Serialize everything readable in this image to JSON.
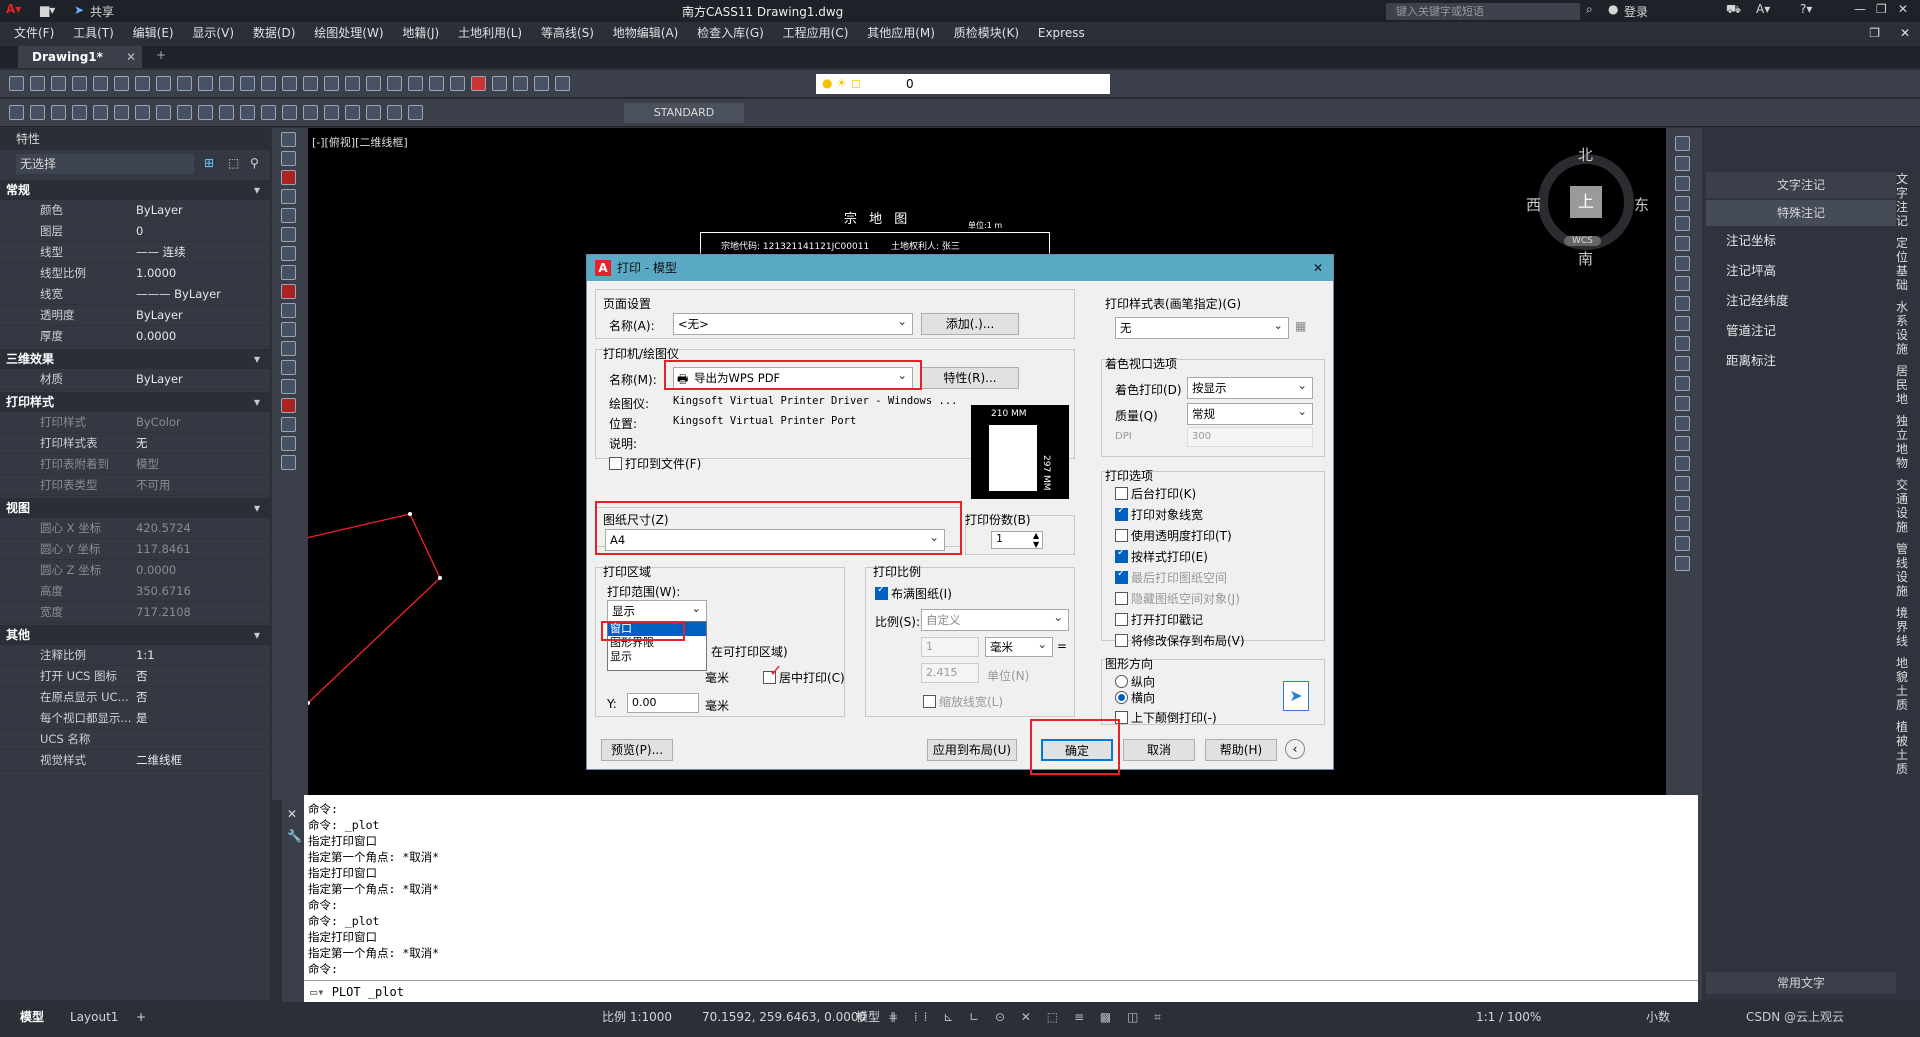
{
  "titlebar": {
    "share": "共享",
    "title": "南方CASS11    Drawing1.dwg",
    "search_placeholder": "键入关键字或短语",
    "login": "登录"
  },
  "menus": [
    "文件(F)",
    "工具(T)",
    "编辑(E)",
    "显示(V)",
    "数据(D)",
    "绘图处理(W)",
    "地籍(J)",
    "土地利用(L)",
    "等高线(S)",
    "地物编辑(A)",
    "检查入库(G)",
    "工程应用(C)",
    "其他应用(M)",
    "质检模块(K)",
    "Express"
  ],
  "tabs": {
    "drawing": "Drawing1*"
  },
  "toolbar": {
    "layer_value": "0",
    "textstyle": "STANDARD"
  },
  "properties": {
    "title": "特性",
    "selection": "无选择",
    "sections": [
      {
        "name": "常规",
        "rows": [
          [
            "颜色",
            "ByLayer"
          ],
          [
            "图层",
            "0"
          ],
          [
            "线型",
            "—— 连续"
          ],
          [
            "线型比例",
            "1.0000"
          ],
          [
            "线宽",
            "——— ByLayer"
          ],
          [
            "透明度",
            "ByLayer"
          ],
          [
            "厚度",
            "0.0000"
          ]
        ]
      },
      {
        "name": "三维效果",
        "rows": [
          [
            "材质",
            "ByLayer"
          ]
        ]
      },
      {
        "name": "打印样式",
        "rows": [
          [
            "打印样式",
            "ByColor"
          ],
          [
            "打印样式表",
            "无"
          ],
          [
            "打印表附着到",
            "模型"
          ],
          [
            "打印表类型",
            "不可用"
          ]
        ]
      },
      {
        "name": "视图",
        "rows": [
          [
            "圆心 X 坐标",
            "420.5724"
          ],
          [
            "圆心 Y 坐标",
            "117.8461"
          ],
          [
            "圆心 Z 坐标",
            "0.0000"
          ],
          [
            "高度",
            "350.6716"
          ],
          [
            "宽度",
            "717.2108"
          ]
        ]
      },
      {
        "name": "其他",
        "rows": [
          [
            "注释比例",
            "1:1"
          ],
          [
            "打开 UCS 图标",
            "否"
          ],
          [
            "在原点显示 UC...",
            "否"
          ],
          [
            "每个视口都显示...",
            "是"
          ],
          [
            "UCS 名称",
            ""
          ],
          [
            "视觉样式",
            "二维线框"
          ]
        ]
      }
    ]
  },
  "canvas": {
    "viewport_label": "[-][俯视][二维线框]",
    "compass": {
      "n": "北",
      "s": "南",
      "e": "东",
      "w": "西",
      "top": "上",
      "wcs": "WCS"
    },
    "drawing_title": "宗 地 图",
    "unit": "单位:1 m",
    "parcel_no": "宗地代码: 121321141121JC00011",
    "owner": "土地权利人: 张三"
  },
  "rightpanel": {
    "items": [
      "文字注记",
      "特殊注记",
      "注记坐标",
      "注记坪高",
      "注记经纬度",
      "管道注记",
      "距离标注"
    ],
    "bottom": "常用文字",
    "vtabs": [
      "文字注记",
      "定位基础",
      "水系设施",
      "居民地",
      "独立地物",
      "交通设施",
      "管线设施",
      "境界线",
      "地貌土质",
      "植被土质"
    ]
  },
  "command": {
    "lines": [
      "命令:",
      "命令: _plot",
      "指定打印窗口",
      "指定第一个角点: *取消*",
      "指定打印窗口",
      "指定第一个角点: *取消*",
      "命令:",
      "命令: _plot",
      "指定打印窗口",
      "指定第一个角点: *取消*",
      "命令:"
    ],
    "input": "PLOT _plot"
  },
  "status": {
    "tab_model": "模型",
    "tab_layout": "Layout1",
    "scale": "比例 1:1000",
    "coords": "70.1592, 259.6463, 0.0000",
    "model": "模型",
    "zoom": "1:1 / 100%",
    "units": "小数",
    "watermark": "CSDN @云上观云"
  },
  "dialog": {
    "title": "打印 - 模型",
    "page_setup": {
      "label": "页面设置",
      "name_label": "名称(A):",
      "name_value": "<无>",
      "add_button": "添加(.)..."
    },
    "printer": {
      "label": "打印机/绘图仪",
      "name_label": "名称(M):",
      "name_value": "导出为WPS PDF",
      "props_button": "特性(R)...",
      "plotter_label": "绘图仪:",
      "plotter_value": "Kingsoft Virtual Printer Driver - Windows ...",
      "location_label": "位置:",
      "location_value": "Kingsoft Virtual Printer Port",
      "desc_label": "说明:",
      "to_file": "打印到文件(F)",
      "paper_w": "210 MM",
      "paper_h": "297 MM"
    },
    "paper": {
      "label": "图纸尺寸(Z)",
      "value": "A4"
    },
    "copies": {
      "label": "打印份数(B)",
      "value": "1"
    },
    "area": {
      "label": "打印区域",
      "range_label": "打印范围(W):",
      "range_value": "显示",
      "options": [
        "窗口",
        "图形界限",
        "显示"
      ],
      "offset_note": "在可打印区域)",
      "center": "居中打印(C)",
      "x_unit": "毫米",
      "y_label": "Y:",
      "y_value": "0.00",
      "y_unit": "毫米"
    },
    "scale": {
      "label": "打印比例",
      "fit": "布满图纸(I)",
      "ratio_label": "比例(S):",
      "ratio_value": "自定义",
      "num": "1",
      "unit": "毫米",
      "denom": "2.415",
      "unit2": "单位(N)",
      "lineweight": "缩放线宽(L)"
    },
    "style_table": {
      "label": "打印样式表(画笔指定)(G)",
      "value": "无"
    },
    "shaded": {
      "label": "着色视口选项",
      "print_label": "着色打印(D)",
      "print_value": "按显示",
      "quality_label": "质量(Q)",
      "quality_value": "常规",
      "dpi_label": "DPI",
      "dpi_value": "300"
    },
    "options": {
      "label": "打印选项",
      "items": [
        [
          "后台打印(K)",
          false,
          false
        ],
        [
          "打印对象线宽",
          true,
          false
        ],
        [
          "使用透明度打印(T)",
          false,
          false
        ],
        [
          "按样式打印(E)",
          true,
          false
        ],
        [
          "最后打印图纸空间",
          true,
          true
        ],
        [
          "隐藏图纸空间对象(J)",
          false,
          true
        ],
        [
          "打开打印戳记",
          false,
          false
        ],
        [
          "将修改保存到布局(V)",
          false,
          false
        ]
      ]
    },
    "orientation": {
      "label": "图形方向",
      "portrait": "纵向",
      "landscape": "横向",
      "upside": "上下颠倒打印(-)"
    },
    "buttons": {
      "preview": "预览(P)...",
      "apply": "应用到布局(U)",
      "ok": "确定",
      "cancel": "取消",
      "help": "帮助(H)"
    }
  },
  "colors": {
    "accent": "#5aa9c5",
    "highlight": "#e8202a",
    "selection": "#0060c0"
  }
}
